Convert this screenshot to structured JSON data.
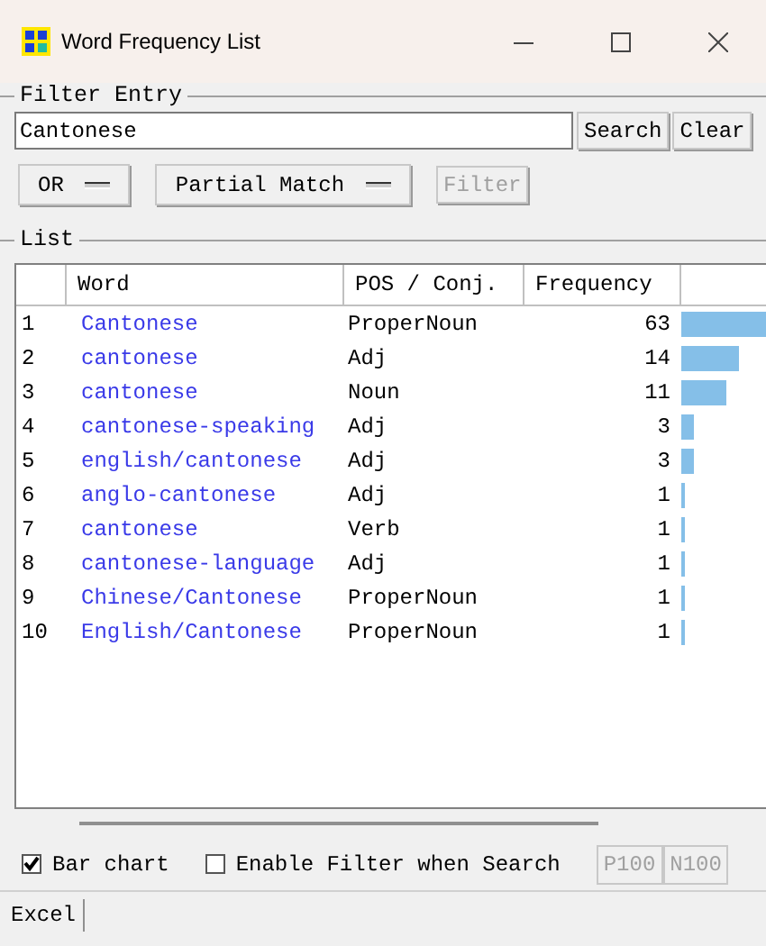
{
  "window": {
    "title": "Word Frequency List"
  },
  "filter_entry": {
    "legend": "Filter Entry",
    "query": "Cantonese",
    "search_button": "Search",
    "clear_button": "Clear",
    "logic_dropdown": "OR",
    "match_dropdown": "Partial Match",
    "filter_button": {
      "label": "Filter",
      "disabled": true
    }
  },
  "list": {
    "legend": "List",
    "columns": [
      "Word",
      "POS / Conj.",
      "Frequency"
    ],
    "rows": [
      {
        "index": "1",
        "word": "Cantonese",
        "pos": "ProperNoun",
        "frequency": "63"
      },
      {
        "index": "2",
        "word": "cantonese",
        "pos": "Adj",
        "frequency": "14"
      },
      {
        "index": "3",
        "word": "cantonese",
        "pos": "Noun",
        "frequency": "11"
      },
      {
        "index": "4",
        "word": "cantonese-speaking",
        "pos": "Adj",
        "frequency": "3"
      },
      {
        "index": "5",
        "word": "english/cantonese",
        "pos": "Adj",
        "frequency": "3"
      },
      {
        "index": "6",
        "word": "anglo-cantonese",
        "pos": "Adj",
        "frequency": "1"
      },
      {
        "index": "7",
        "word": "cantonese",
        "pos": "Verb",
        "frequency": "1"
      },
      {
        "index": "8",
        "word": "cantonese-language",
        "pos": "Adj",
        "frequency": "1"
      },
      {
        "index": "9",
        "word": "Chinese/Cantonese",
        "pos": "ProperNoun",
        "frequency": "1"
      },
      {
        "index": "10",
        "word": "English/Cantonese",
        "pos": "ProperNoun",
        "frequency": "1"
      }
    ]
  },
  "options": [
    {
      "label": "Bar chart",
      "checked": true
    },
    {
      "label": "Enable Filter when Search",
      "checked": false
    }
  ],
  "page_buttons": [
    {
      "label": "P100",
      "disabled": true
    },
    {
      "label": "N100",
      "disabled": true
    }
  ],
  "bottom_tabs": [
    "Excel"
  ]
}
